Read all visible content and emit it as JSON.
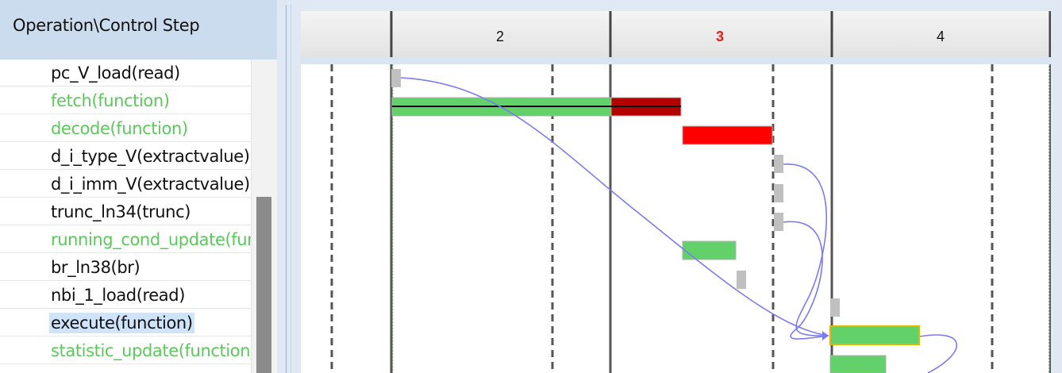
{
  "header": {
    "title": "Operation\\Control Step"
  },
  "operations": [
    {
      "label": "pc_V_load(read)",
      "color": "#111111",
      "highlighted": false
    },
    {
      "label": "fetch(function)",
      "color": "#5cc85c",
      "highlighted": false
    },
    {
      "label": "decode(function)",
      "color": "#5cc85c",
      "highlighted": false
    },
    {
      "label": "d_i_type_V(extractvalue)",
      "color": "#111111",
      "highlighted": false
    },
    {
      "label": "d_i_imm_V(extractvalue)",
      "color": "#111111",
      "highlighted": false
    },
    {
      "label": "trunc_ln34(trunc)",
      "color": "#111111",
      "highlighted": false
    },
    {
      "label": "running_cond_update(function)",
      "color": "#5cc85c",
      "highlighted": false
    },
    {
      "label": "br_ln38(br)",
      "color": "#111111",
      "highlighted": false
    },
    {
      "label": "nbi_1_load(read)",
      "color": "#111111",
      "highlighted": false
    },
    {
      "label": "execute(function)",
      "color": "#111111",
      "highlighted": true
    },
    {
      "label": "statistic_update(function)",
      "color": "#5cc85c",
      "highlighted": false
    }
  ],
  "control_steps": [
    {
      "label": "2",
      "color": "#111111"
    },
    {
      "label": "3",
      "color": "#e02020"
    },
    {
      "label": "4",
      "color": "#111111"
    }
  ],
  "colors": {
    "function_bar": "#63d16a",
    "critical_bar": "#ff0000",
    "critical_dark": "#b30000",
    "small_op": "#c0c0c0",
    "dependency_line": "#7b7bef",
    "selected_border": "#e8b400"
  }
}
